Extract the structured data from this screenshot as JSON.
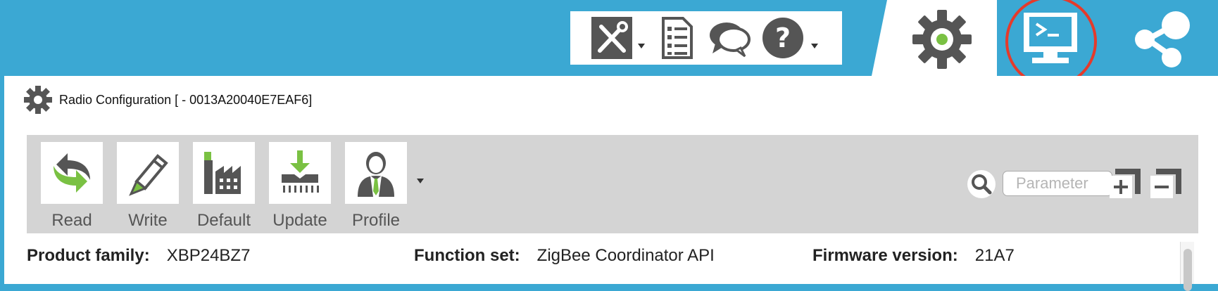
{
  "panel": {
    "title": "Radio Configuration [  - 0013A20040E7EAF6]"
  },
  "toolbar": {
    "buttons": [
      {
        "label": "Read"
      },
      {
        "label": "Write"
      },
      {
        "label": "Default"
      },
      {
        "label": "Update"
      },
      {
        "label": "Profile"
      }
    ],
    "search_placeholder": "Parameter"
  },
  "info": {
    "product_family_label": "Product family:",
    "product_family_value": "XBP24BZ7",
    "function_set_label": "Function set:",
    "function_set_value": "ZigBee Coordinator API",
    "firmware_label": "Firmware version:",
    "firmware_value": "21A7"
  },
  "colors": {
    "header_bg": "#3ba8d3",
    "icon_gray": "#555555",
    "accent_green": "#7ac143",
    "highlight_red": "#e53a2b",
    "toolbar_bg": "#d4d4d4"
  },
  "icons": [
    "tools-icon",
    "document-list-icon",
    "chat-icon",
    "help-icon",
    "configuration-mode-icon",
    "console-mode-icon",
    "network-mode-icon",
    "gear-icon",
    "read-icon",
    "write-icon",
    "default-icon",
    "update-icon",
    "profile-icon",
    "search-icon",
    "expand-all-icon",
    "collapse-all-icon"
  ]
}
